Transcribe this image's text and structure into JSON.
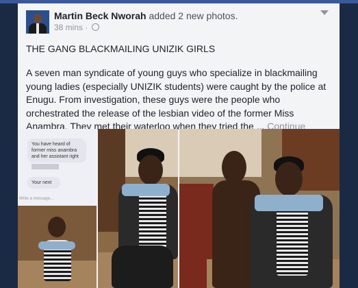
{
  "post": {
    "author": "Martin Beck Nworah",
    "action": " added 2 new photos.",
    "time": "38 mins",
    "dot": "·",
    "title": "THE GANG BLACKMAILING UNIZIK GIRLS",
    "body": "A seven man syndicate of young guys who specialize in blackmailing young ladies (especially UNIZIK students) were caught by the police at Enugu. From investigation, these guys were the people who orchestrated the release of the lesbian video of the former Miss Anambra. They met their waterloo when they tried the ... ",
    "continue_reading": "Continue Reading"
  },
  "chat_screenshot": {
    "message_1": "You have heard of former miss anambra and her assistant right",
    "message_2": "Your next",
    "composer": "Write a message..."
  },
  "icons": [
    "globe-icon",
    "chevron-down-icon"
  ],
  "colors": {
    "brand_bar": "#3b5998",
    "background": "#1b2a44",
    "card": "#f3f4f6",
    "muted": "#90949c"
  }
}
